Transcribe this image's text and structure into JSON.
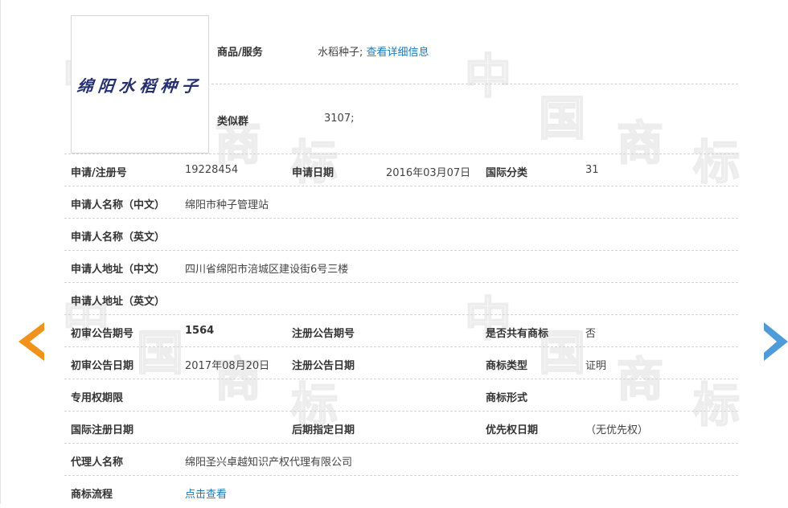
{
  "watermark": {
    "chars": [
      "中",
      "国",
      "商",
      "标"
    ]
  },
  "trademark": {
    "image_text": "绵阳水稻种子"
  },
  "goods": {
    "label": "商品/服务",
    "value": "水稻种子;",
    "detail_link": "查看详细信息"
  },
  "similar_group": {
    "label": "类似群",
    "value": "3107;"
  },
  "rows": {
    "reg_no": {
      "label": "申请/注册号",
      "value": "19228454"
    },
    "app_date": {
      "label": "申请日期",
      "value": "2016年03月07日"
    },
    "intl_class": {
      "label": "国际分类",
      "value": "31"
    },
    "applicant_cn": {
      "label": "申请人名称（中文）",
      "value": "绵阳市种子管理站"
    },
    "applicant_en": {
      "label": "申请人名称（英文）",
      "value": ""
    },
    "address_cn": {
      "label": "申请人地址（中文）",
      "value": "四川省绵阳市涪城区建设街6号三楼"
    },
    "address_en": {
      "label": "申请人地址（英文）",
      "value": ""
    },
    "prelim_issue": {
      "label": "初审公告期号",
      "value": "1564"
    },
    "reg_issue": {
      "label": "注册公告期号",
      "value": ""
    },
    "shared": {
      "label": "是否共有商标",
      "value": "否"
    },
    "prelim_date": {
      "label": "初审公告日期",
      "value": "2017年08月20日"
    },
    "reg_date": {
      "label": "注册公告日期",
      "value": ""
    },
    "tm_type": {
      "label": "商标类型",
      "value": "证明"
    },
    "exclusive": {
      "label": "专用权期限",
      "value": ""
    },
    "tm_form": {
      "label": "商标形式",
      "value": ""
    },
    "intl_reg_date": {
      "label": "国际注册日期",
      "value": ""
    },
    "later_date": {
      "label": "后期指定日期",
      "value": ""
    },
    "priority_date": {
      "label": "优先权日期",
      "value": "（无优先权）"
    },
    "agent": {
      "label": "代理人名称",
      "value": "绵阳圣兴卓越知识产权代理有限公司"
    },
    "flow": {
      "label": "商标流程",
      "link": "点击查看"
    }
  },
  "colors": {
    "prev_arrow": "#f0921c",
    "next_arrow": "#4f9bd9",
    "link": "#1b7ab8"
  }
}
